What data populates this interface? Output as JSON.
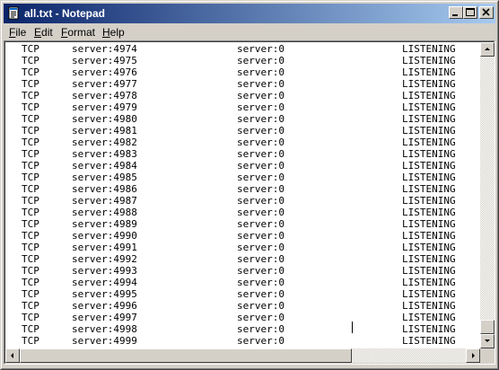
{
  "window": {
    "title": "all.txt - Notepad",
    "icons": {
      "app": "notepad-icon",
      "minimize": "minimize-icon",
      "maximize": "maximize-icon",
      "close": "close-icon"
    }
  },
  "menu": [
    {
      "accel": "F",
      "rest": "ile"
    },
    {
      "accel": "E",
      "rest": "dit"
    },
    {
      "accel": "F",
      "rest": "ormat"
    },
    {
      "accel": "H",
      "rest": "elp"
    }
  ],
  "lines": [
    {
      "proto": "TCP",
      "local": "server:4974",
      "foreign": "server:0",
      "state": "LISTENING"
    },
    {
      "proto": "TCP",
      "local": "server:4975",
      "foreign": "server:0",
      "state": "LISTENING"
    },
    {
      "proto": "TCP",
      "local": "server:4976",
      "foreign": "server:0",
      "state": "LISTENING"
    },
    {
      "proto": "TCP",
      "local": "server:4977",
      "foreign": "server:0",
      "state": "LISTENING"
    },
    {
      "proto": "TCP",
      "local": "server:4978",
      "foreign": "server:0",
      "state": "LISTENING"
    },
    {
      "proto": "TCP",
      "local": "server:4979",
      "foreign": "server:0",
      "state": "LISTENING"
    },
    {
      "proto": "TCP",
      "local": "server:4980",
      "foreign": "server:0",
      "state": "LISTENING"
    },
    {
      "proto": "TCP",
      "local": "server:4981",
      "foreign": "server:0",
      "state": "LISTENING"
    },
    {
      "proto": "TCP",
      "local": "server:4982",
      "foreign": "server:0",
      "state": "LISTENING"
    },
    {
      "proto": "TCP",
      "local": "server:4983",
      "foreign": "server:0",
      "state": "LISTENING"
    },
    {
      "proto": "TCP",
      "local": "server:4984",
      "foreign": "server:0",
      "state": "LISTENING"
    },
    {
      "proto": "TCP",
      "local": "server:4985",
      "foreign": "server:0",
      "state": "LISTENING"
    },
    {
      "proto": "TCP",
      "local": "server:4986",
      "foreign": "server:0",
      "state": "LISTENING"
    },
    {
      "proto": "TCP",
      "local": "server:4987",
      "foreign": "server:0",
      "state": "LISTENING"
    },
    {
      "proto": "TCP",
      "local": "server:4988",
      "foreign": "server:0",
      "state": "LISTENING"
    },
    {
      "proto": "TCP",
      "local": "server:4989",
      "foreign": "server:0",
      "state": "LISTENING"
    },
    {
      "proto": "TCP",
      "local": "server:4990",
      "foreign": "server:0",
      "state": "LISTENING"
    },
    {
      "proto": "TCP",
      "local": "server:4991",
      "foreign": "server:0",
      "state": "LISTENING"
    },
    {
      "proto": "TCP",
      "local": "server:4992",
      "foreign": "server:0",
      "state": "LISTENING"
    },
    {
      "proto": "TCP",
      "local": "server:4993",
      "foreign": "server:0",
      "state": "LISTENING"
    },
    {
      "proto": "TCP",
      "local": "server:4994",
      "foreign": "server:0",
      "state": "LISTENING"
    },
    {
      "proto": "TCP",
      "local": "server:4995",
      "foreign": "server:0",
      "state": "LISTENING"
    },
    {
      "proto": "TCP",
      "local": "server:4996",
      "foreign": "server:0",
      "state": "LISTENING"
    },
    {
      "proto": "TCP",
      "local": "server:4997",
      "foreign": "server:0",
      "state": "LISTENING"
    },
    {
      "proto": "TCP",
      "local": "server:4998",
      "foreign": "server:0",
      "state": "LISTENING"
    },
    {
      "proto": "TCP",
      "local": "server:4999",
      "foreign": "server:0",
      "state": "LISTENING"
    }
  ],
  "scrollbars": {
    "vertical_position": 1.0,
    "horizontal_position": 0.0
  },
  "colors": {
    "title_start": "#0a246a",
    "title_end": "#a6caf0",
    "face": "#d4d0c8"
  }
}
